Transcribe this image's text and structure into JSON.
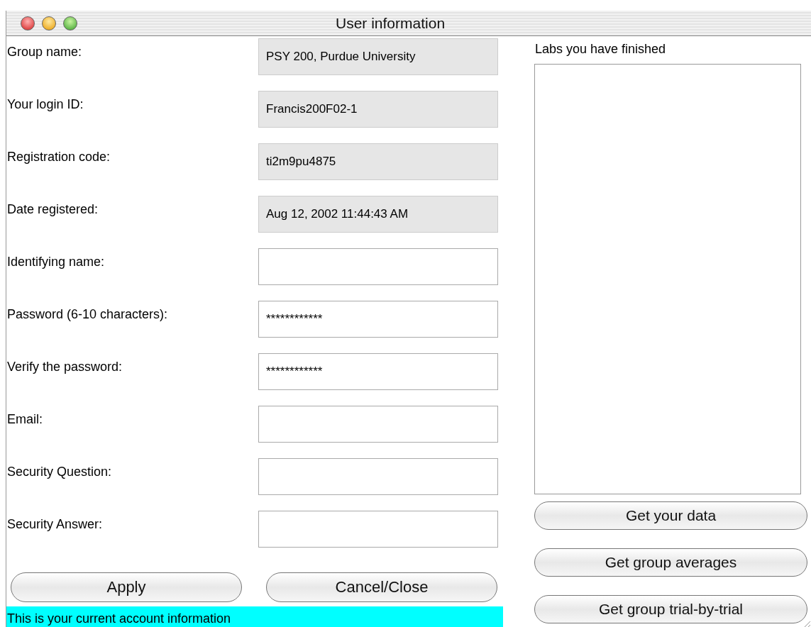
{
  "window": {
    "title": "User information"
  },
  "fields": [
    {
      "label": "Group name:",
      "value": "PSY 200, Purdue University",
      "read_only": true
    },
    {
      "label": "Your login ID:",
      "value": "Francis200F02-1",
      "read_only": true
    },
    {
      "label": "Registration code:",
      "value": "ti2m9pu4875",
      "read_only": true
    },
    {
      "label": "Date registered:",
      "value": "Aug 12, 2002 11:44:43 AM",
      "read_only": true
    },
    {
      "label": "Identifying name:",
      "read_only": false
    },
    {
      "label": "Password (6-10 characters):",
      "value": "************",
      "read_only": false
    },
    {
      "label": "Verify the password:",
      "value": "************",
      "read_only": false
    },
    {
      "label": "Email:",
      "read_only": false
    },
    {
      "label": "Security Question:",
      "read_only": false
    },
    {
      "label": "Security Answer:",
      "read_only": false
    }
  ],
  "buttons": [
    "Apply",
    "Cancel/Close"
  ],
  "status": "This is your current account information",
  "labs": {
    "label": "Labs you have finished"
  },
  "data_buttons": [
    "Get your data",
    "Get group averages",
    "Get group trial-by-trial"
  ]
}
